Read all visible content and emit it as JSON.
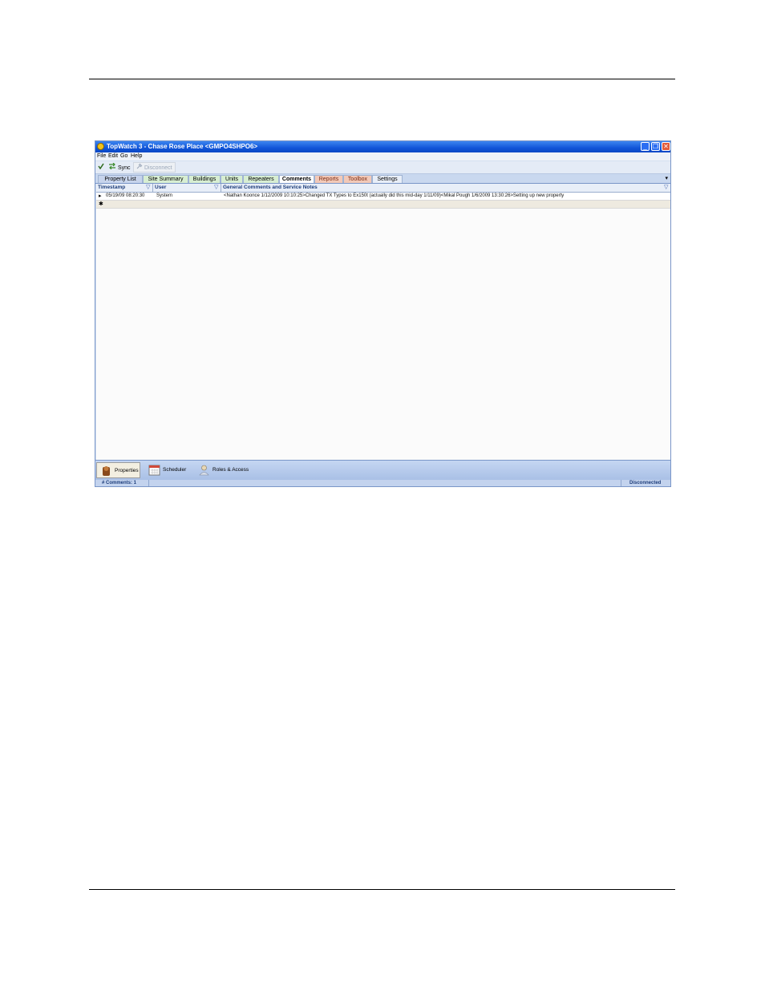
{
  "window": {
    "title": "TopWatch 3 - Chase Rose Place <GMPO4SHPO6>",
    "controls": {
      "minimize": "_",
      "maximize": "❐",
      "close": "✕"
    }
  },
  "menu": [
    "File",
    "Edit",
    "Go",
    "Help"
  ],
  "toolbar": {
    "sync_label": "Sync",
    "disconnect_label": "Disconnect",
    "check_icon": "check-icon",
    "sync_icon": "sync-arrows-icon",
    "disconnect_icon": "plug-icon"
  },
  "tabs": [
    {
      "label": "Property List",
      "color": "#c7d4ec"
    },
    {
      "label": "Site Summary",
      "color": "#d7eed2"
    },
    {
      "label": "Buildings",
      "color": "#d7eed2"
    },
    {
      "label": "Units",
      "color": "#d7eed2"
    },
    {
      "label": "Repeaters",
      "color": "#d7eed2"
    },
    {
      "label": "Comments",
      "color": "#ffffff",
      "active": true
    },
    {
      "label": "Reports",
      "color": "#f2c9b8"
    },
    {
      "label": "Toolbox",
      "color": "#f2c9b8"
    },
    {
      "label": "Settings",
      "color": "#e8eef8"
    }
  ],
  "grid": {
    "columns": [
      "Timestamp",
      "User",
      "General Comments and Service Notes"
    ],
    "rows": [
      {
        "timestamp": "05/19/09 08:20:30",
        "user": "System",
        "notes": "<Nathan Koonce 1/12/2009 10:10:25>Changed TX Types to Ex150t (actually did this mid-day 1/11/09)<Mikal Pough 1/6/2009 13:30:26>Setting up new property"
      }
    ],
    "row_indicator": "▸",
    "new_row_indicator": "✱"
  },
  "nav": [
    {
      "label": "Properties",
      "icon": "properties-icon",
      "active": true
    },
    {
      "label": "Scheduler",
      "icon": "calendar-icon"
    },
    {
      "label": "Roles & Access",
      "icon": "user-icon"
    }
  ],
  "status": {
    "comments": "# Comments: 1",
    "connection": "Disconnected"
  },
  "colors": {
    "titlebar": "#1155d8",
    "accent": "#7a96c8"
  }
}
